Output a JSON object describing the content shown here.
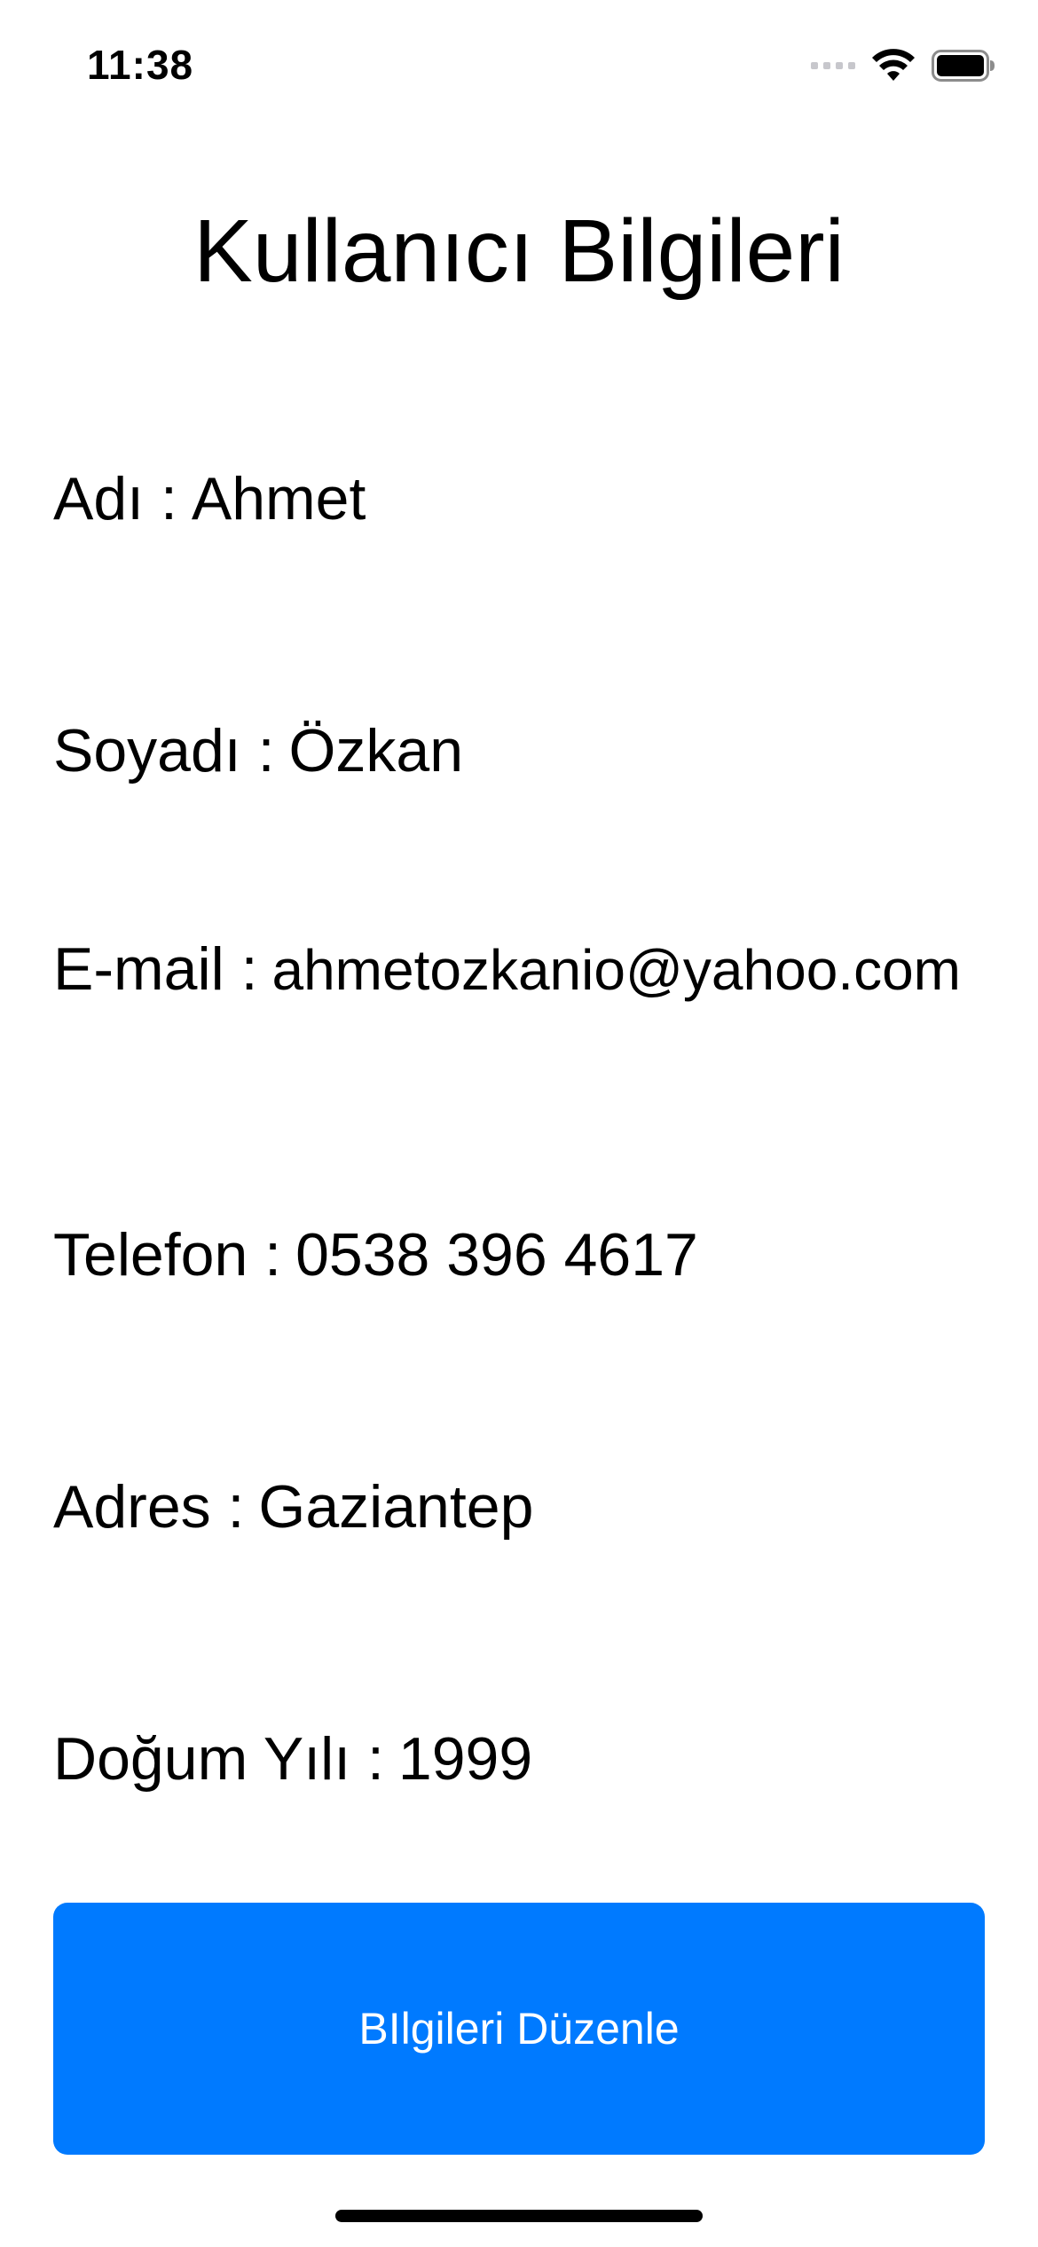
{
  "status_bar": {
    "time": "11:38",
    "icons": [
      "signal-icon",
      "wifi-icon",
      "battery-icon"
    ]
  },
  "page": {
    "title": "Kullanıcı Bilgileri"
  },
  "fields": [
    {
      "label": "Adı :",
      "value": "Ahmet"
    },
    {
      "label": "Soyadı :",
      "value": "Özkan"
    },
    {
      "label": "E-mail :",
      "value": "ahmetozkanio@yahoo.com"
    },
    {
      "label": "Telefon :",
      "value": "0538 396 4617"
    },
    {
      "label": "Adres :",
      "value": "Gaziantep"
    },
    {
      "label": "Doğum Yılı :",
      "value": "1999"
    }
  ],
  "edit_button": {
    "label": "BIlgileri Düzenle",
    "color": "#007aff"
  }
}
